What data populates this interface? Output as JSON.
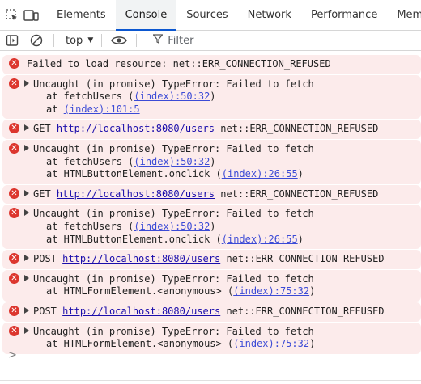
{
  "tabs": [
    {
      "label": "Elements"
    },
    {
      "label": "Console"
    },
    {
      "label": "Sources"
    },
    {
      "label": "Network"
    },
    {
      "label": "Performance"
    },
    {
      "label": "Mem"
    }
  ],
  "toolbar": {
    "context": "top",
    "filter_placeholder": "Filter"
  },
  "messages": [
    {
      "head": "Failed to load resource: net::ERR_CONNECTION_REFUSED"
    },
    {
      "head": "Uncaught (in promise) TypeError: Failed to fetch",
      "frames": [
        {
          "pre": "at fetchUsers (",
          "src": "(index):50:32",
          "post": ")"
        },
        {
          "pre": "at ",
          "src": "(index):101:5",
          "post": ""
        }
      ]
    },
    {
      "method": "GET",
      "url": "http://localhost:8080/users",
      "err": "net::ERR_CONNECTION_REFUSED"
    },
    {
      "head": "Uncaught (in promise) TypeError: Failed to fetch",
      "frames": [
        {
          "pre": "at fetchUsers (",
          "src": "(index):50:32",
          "post": ")"
        },
        {
          "pre": "at HTMLButtonElement.onclick (",
          "src": "(index):26:55",
          "post": ")"
        }
      ]
    },
    {
      "method": "GET",
      "url": "http://localhost:8080/users",
      "err": "net::ERR_CONNECTION_REFUSED"
    },
    {
      "head": "Uncaught (in promise) TypeError: Failed to fetch",
      "frames": [
        {
          "pre": "at fetchUsers (",
          "src": "(index):50:32",
          "post": ")"
        },
        {
          "pre": "at HTMLButtonElement.onclick (",
          "src": "(index):26:55",
          "post": ")"
        }
      ]
    },
    {
      "method": "POST",
      "url": "http://localhost:8080/users",
      "err": "net::ERR_CONNECTION_REFUSED"
    },
    {
      "head": "Uncaught (in promise) TypeError: Failed to fetch",
      "frames": [
        {
          "pre": "at HTMLFormElement.<anonymous> (",
          "src": "(index):75:32",
          "post": ")"
        }
      ]
    },
    {
      "method": "POST",
      "url": "http://localhost:8080/users",
      "err": "net::ERR_CONNECTION_REFUSED"
    },
    {
      "head": "Uncaught (in promise) TypeError: Failed to fetch",
      "frames": [
        {
          "pre": "at HTMLFormElement.<anonymous> (",
          "src": "(index):75:32",
          "post": ")"
        }
      ]
    }
  ],
  "prompt_symbol": ">",
  "colors": {
    "error_bg": "#fcebeb",
    "error_icon": "#dc362e",
    "accent": "#0b57d0",
    "link": "#1a0dab"
  }
}
